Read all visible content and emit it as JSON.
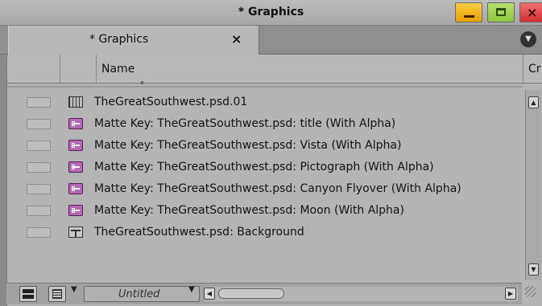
{
  "window": {
    "title": "* Graphics"
  },
  "tab": {
    "label": "* Graphics",
    "close_glyph": "×",
    "menu_icon": "menu-circle-icon"
  },
  "columns": {
    "name": "Name",
    "truncated": "Cr"
  },
  "rows": [
    {
      "label": "TheGreatSouthwest.psd.01",
      "icon": "sequence-icon"
    },
    {
      "label": "Matte Key: TheGreatSouthwest.psd: title  (With Alpha)",
      "icon": "matte-key-icon"
    },
    {
      "label": "Matte Key: TheGreatSouthwest.psd: Vista (With Alpha)",
      "icon": "matte-key-icon"
    },
    {
      "label": "Matte Key: TheGreatSouthwest.psd: Pictograph (With Alpha)",
      "icon": "matte-key-icon"
    },
    {
      "label": "Matte Key: TheGreatSouthwest.psd: Canyon Flyover (With Alpha)",
      "icon": "matte-key-icon"
    },
    {
      "label": "Matte Key: TheGreatSouthwest.psd: Moon (With Alpha)",
      "icon": "matte-key-icon"
    },
    {
      "label": "TheGreatSouthwest.psd: Background",
      "icon": "background-clip-icon"
    }
  ],
  "toolbar": {
    "view": "Untitled"
  },
  "colors": {
    "matte_icon": "#b36ab3",
    "minimize": "#f0b020",
    "maximize": "#9acd50",
    "close": "#e04848"
  }
}
